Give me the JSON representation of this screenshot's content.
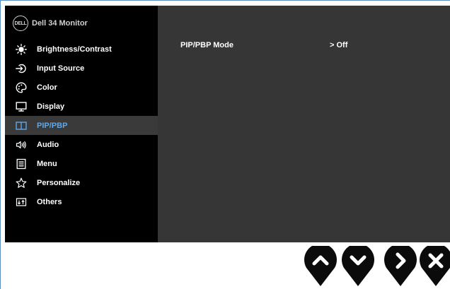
{
  "brand": {
    "logo_text": "DELL",
    "model": "Dell 34 Monitor"
  },
  "menu": {
    "items": [
      {
        "label": "Brightness/Contrast",
        "icon": "brightness-icon"
      },
      {
        "label": "Input Source",
        "icon": "input-source-icon"
      },
      {
        "label": "Color",
        "icon": "color-palette-icon"
      },
      {
        "label": "Display",
        "icon": "display-icon"
      },
      {
        "label": "PIP/PBP",
        "icon": "pip-pbp-icon",
        "active": true
      },
      {
        "label": "Audio",
        "icon": "audio-icon"
      },
      {
        "label": "Menu",
        "icon": "menu-icon"
      },
      {
        "label": "Personalize",
        "icon": "star-icon"
      },
      {
        "label": "Others",
        "icon": "others-icon"
      }
    ],
    "active_color": "#5da7ec"
  },
  "content": {
    "setting_name": "PIP/PBP Mode",
    "setting_value": "> Off"
  },
  "nav_buttons": [
    {
      "icon": "chevron-up-icon"
    },
    {
      "icon": "chevron-down-icon"
    },
    {
      "icon": "chevron-right-icon"
    },
    {
      "icon": "close-icon"
    }
  ]
}
